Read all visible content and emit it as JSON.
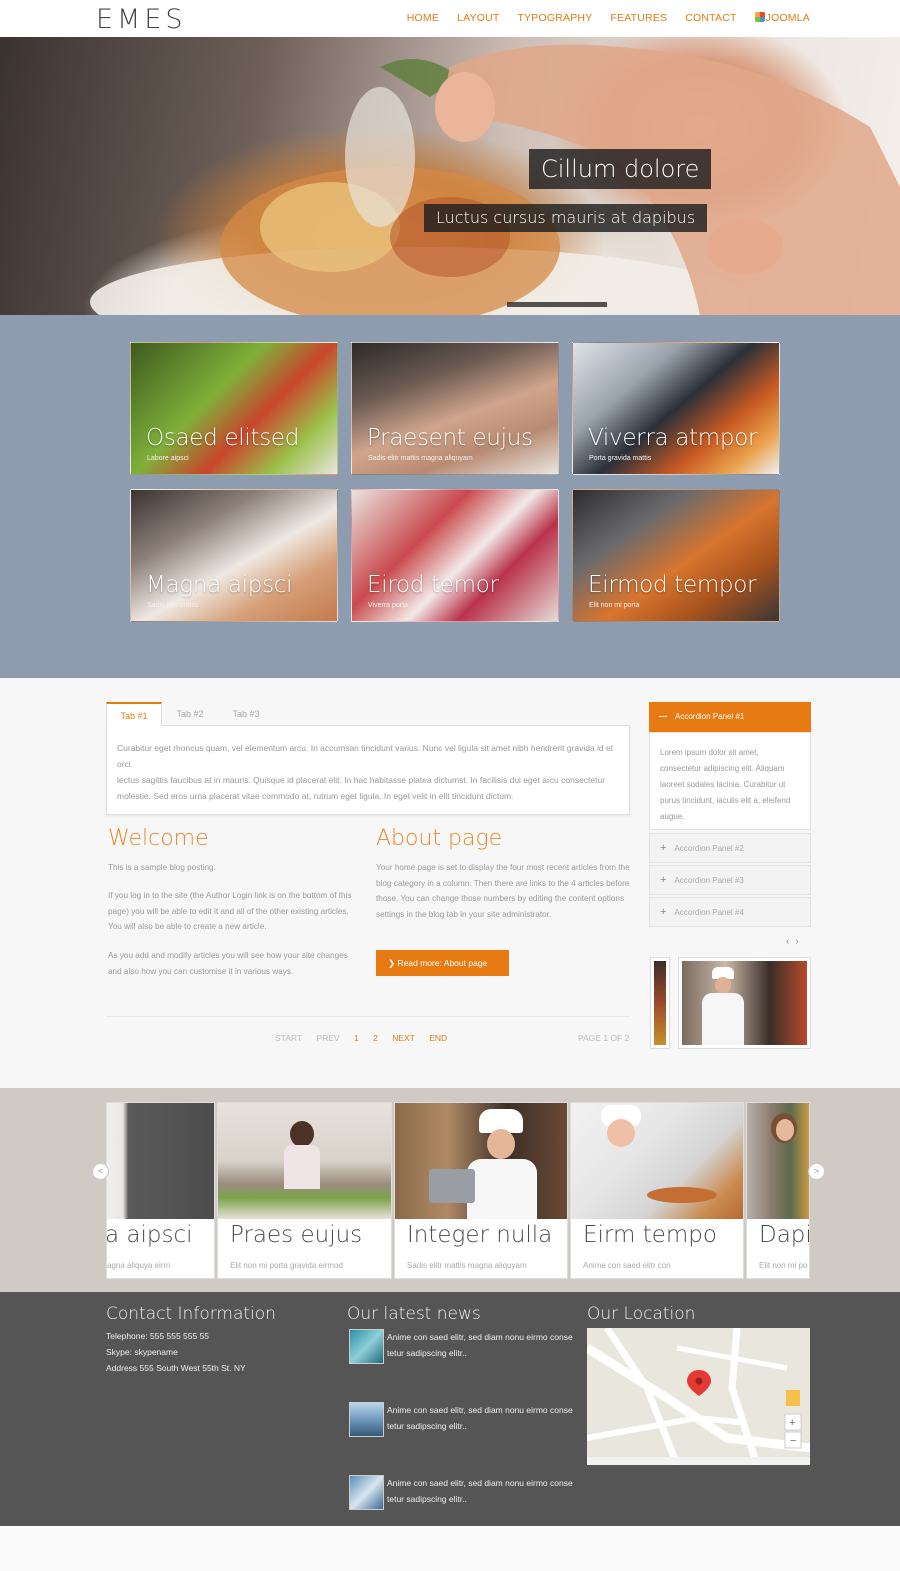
{
  "header": {
    "logo": "EMES",
    "nav": [
      "HOME",
      "LAYOUT",
      "TYPOGRAPHY",
      "FEATURES",
      "CONTACT",
      "JOOMLA"
    ]
  },
  "hero": {
    "caption_title": "Cillum dolore",
    "caption_sub": "Luctus cursus mauris at dapibus"
  },
  "gallery": [
    {
      "title": "Osaed elitsed",
      "sub": "Labore aipsci"
    },
    {
      "title": "Praesent eujus",
      "sub": "Sadis elitr mattis magna aliquyam"
    },
    {
      "title": "Viverra atmpor",
      "sub": "Porta gravida mattis"
    },
    {
      "title": "Magna aipsci",
      "sub": "Sadis elitr mattis"
    },
    {
      "title": "Eirod temor",
      "sub": "Viverra porta"
    },
    {
      "title": "Eirmod tempor",
      "sub": "Elit non mi porta"
    }
  ],
  "tabs": {
    "labels": [
      "Tab #1",
      "Tab #2",
      "Tab #3"
    ],
    "content_1": "Curabitur eget rhoncus quam, vel elementum arcu. In accumsan tincidunt varius. Nunc vel ligula sit amet nibh hendrerit gravida id et orci.",
    "content_2": "lectus sagittis faucibus at in mauris. Quisque id placerat elit. In hac habitasse platea dictumst. In facilisis dui eget arcu consectetur molestie. Sed eros urna placerat vitae commodo at, rutrum eget ligula. In eget velit in elit tincidunt dictum."
  },
  "welcome": {
    "title": "Welcome",
    "p1": "This is a sample blog posting.",
    "p2": "If you log in to the site (the Author Login link is on the bottom of this page) you will be able to edit it and all of the other existing articles. You will also be able to create a new article.",
    "p3": "As you add and modify articles you will see how your site changes and also how you can customise it in various ways."
  },
  "about": {
    "title": "About page",
    "p1": "Your home page is set to display the four most recent articles from the blog category in a column. Then there are links to the 4 articles before those. You can change those numbers by editing the content options settings in the blog tab in your site administrator.",
    "button": "Read more: About page"
  },
  "pagination": {
    "start": "START",
    "prev": "PREV",
    "p1": "1",
    "p2": "2",
    "next": "NEXT",
    "end": "END",
    "info": "PAGE 1 OF 2"
  },
  "accordion": {
    "panel1": "Accordion Panel #1",
    "panel1_body": "Lorem ipsum dolor sit amet, consectetur adipiscing elit. Aliquam laoreet sodales lacinia. Curabitur ut purus tincidunt, iaculis elit a, eleifend augue.",
    "panel2": "Accordion Panel #2",
    "panel3": "Accordion Panel #3",
    "panel4": "Accordion Panel #4"
  },
  "strip_cards": [
    {
      "title": "a aipsci",
      "sub": "agna aliquya eirm"
    },
    {
      "title": "Praes eujus",
      "sub": "Elit non mi porta gravida eirmod"
    },
    {
      "title": "Integer nulla",
      "sub": "Sadis elitr mattis magna aliquyam"
    },
    {
      "title": "Eirm tempo",
      "sub": "Anime con saed elitr con"
    },
    {
      "title": "Dapi",
      "sub": "Elit non mi po"
    }
  ],
  "footer": {
    "contact_title": "Contact Information",
    "telephone": "Telephone: 555 555 555 55",
    "skype": "Skype: skypename",
    "address": "Address 555 South West 55th St. NY",
    "news_title": "Our latest news",
    "news_item": "Anime con saed elitr, sed diam nonu eirmo conse tetur sadipscing elitr..",
    "location_title": "Our Location"
  },
  "colors": {
    "accent": "#e87a13",
    "gallery_bg": "#8e9cb0",
    "footer_bg": "#555555"
  }
}
